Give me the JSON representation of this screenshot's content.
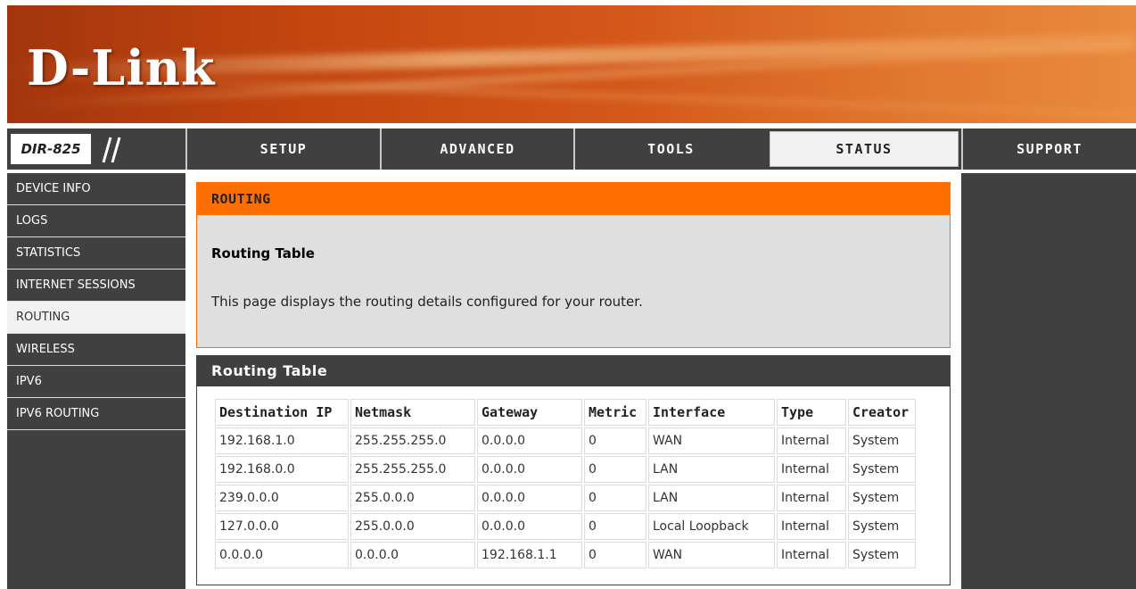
{
  "brand": {
    "logo_text": "D-Link",
    "model": "DIR-825"
  },
  "tabs": [
    {
      "label": "SETUP"
    },
    {
      "label": "ADVANCED"
    },
    {
      "label": "TOOLS"
    },
    {
      "label": "STATUS",
      "active": true
    },
    {
      "label": "SUPPORT"
    }
  ],
  "sidebar": {
    "items": [
      {
        "label": "DEVICE INFO"
      },
      {
        "label": "LOGS"
      },
      {
        "label": "STATISTICS"
      },
      {
        "label": "INTERNET SESSIONS"
      },
      {
        "label": "ROUTING",
        "active": true
      },
      {
        "label": "WIRELESS"
      },
      {
        "label": "IPV6"
      },
      {
        "label": "IPV6 ROUTING"
      }
    ]
  },
  "routing": {
    "header": "ROUTING",
    "subtitle": "Routing Table",
    "description": "This page displays the routing details configured for your router."
  },
  "routing_table": {
    "header": "Routing Table",
    "columns": [
      "Destination IP",
      "Netmask",
      "Gateway",
      "Metric",
      "Interface",
      "Type",
      "Creator"
    ],
    "rows": [
      [
        "192.168.1.0",
        "255.255.255.0",
        "0.0.0.0",
        "0",
        "WAN",
        "Internal",
        "System"
      ],
      [
        "192.168.0.0",
        "255.255.255.0",
        "0.0.0.0",
        "0",
        "LAN",
        "Internal",
        "System"
      ],
      [
        "239.0.0.0",
        "255.0.0.0",
        "0.0.0.0",
        "0",
        "LAN",
        "Internal",
        "System"
      ],
      [
        "127.0.0.0",
        "255.0.0.0",
        "0.0.0.0",
        "0",
        "Local Loopback",
        "Internal",
        "System"
      ],
      [
        "0.0.0.0",
        "0.0.0.0",
        "192.168.1.1",
        "0",
        "WAN",
        "Internal",
        "System"
      ]
    ]
  },
  "colors": {
    "accent_orange": "#ff6f00",
    "dark_gray": "#404040",
    "panel_gray": "#dfdfdf"
  }
}
